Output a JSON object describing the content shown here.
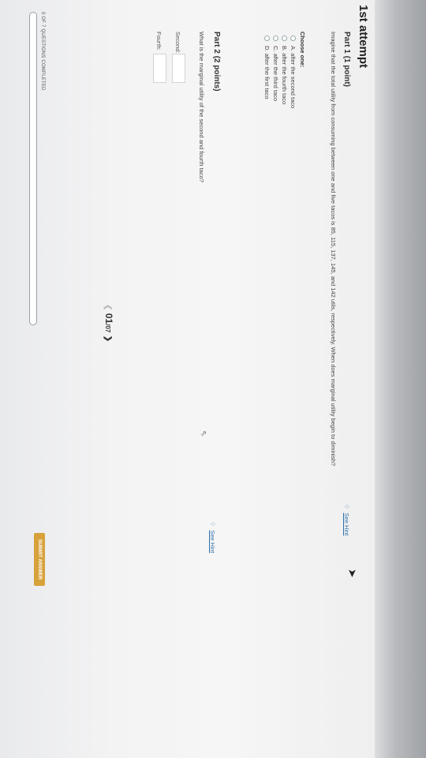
{
  "attempt_title": "1st attempt",
  "part1": {
    "title": "Part 1  (1 point)",
    "hint": "See Hint",
    "question": "Imagine that the total utility from consuming between one and five tacos is 85, 115, 137, 145, and 142 utils, respectively. When does marginal utility begin to diminish?",
    "choose_label": "Choose one:",
    "options": [
      "A. after the second taco",
      "B. after the fourth taco",
      "C. after the third taco",
      "D. after the first taco"
    ]
  },
  "part2": {
    "title": "Part 2  (2 points)",
    "hint": "See Hint",
    "question": "What is the marginal utility of the second and fourth taco?",
    "field_second_label": "Second:",
    "field_fourth_label": "Fourth:"
  },
  "pager": {
    "current": "01",
    "total": "07",
    "prev_icon": "chevron-left-icon",
    "next_icon": "chevron-right-icon"
  },
  "footer": {
    "completed_text": "0 OF 7 QUESTIONS COMPLETED",
    "submit_label": "SUBMIT ANSWER",
    "progress_fraction": 0
  },
  "colors": {
    "accent_link": "#2a6ea8",
    "submit_bg": "#d7a13b"
  }
}
